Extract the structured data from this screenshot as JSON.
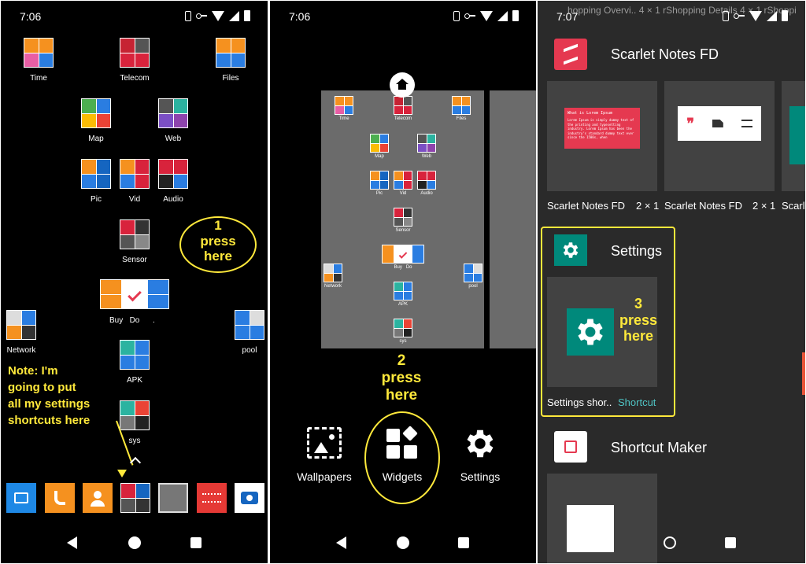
{
  "panel1": {
    "status_time": "7:06",
    "apps": {
      "time": "Time",
      "telecom": "Telecom",
      "files": "Files",
      "map": "Map",
      "web": "Web",
      "pic": "Pic",
      "vid": "Vid",
      "audio": "Audio",
      "sensor": "Sensor",
      "buydo": "Buy   Do      .",
      "network": "Network",
      "pool": "pool",
      "apk": "APK",
      "sys": "sys"
    },
    "annotation_press": "1\npress\nhere",
    "note": "Note: I'm\ngoing to put\nall my settings\nshortcuts here"
  },
  "panel2": {
    "status_time": "7:06",
    "mini_labels": {
      "time": "Time",
      "telecom": "Telecom",
      "files": "Files",
      "map": "Map",
      "web": "Web",
      "pic": "Pic",
      "vid": "Vid",
      "audio": "Audio",
      "sensor": "Sensor",
      "buydo": "Buy   Do",
      "network": "Network",
      "pool": "pool",
      "apk": "APK",
      "sys": "sys"
    },
    "annotation_press": "2\npress\nhere",
    "options": {
      "wallpapers": "Wallpapers",
      "widgets": "Widgets",
      "settings": "Settings"
    }
  },
  "panel3": {
    "status_time": "7:07",
    "status_overlay": "hopping Overvi..  4 × 1   rShopping Details  4 × 1   rShoppi",
    "scarlet": {
      "title": "Scarlet Notes FD",
      "note_title": "What is Lorem Ipsum",
      "note_body": "Lorem Ipsum is simply dummy text of the printing and typesetting industry. Lorem Ipsum has been the industry's standard dummy text ever since the 1500s, when",
      "w1_name": "Scarlet Notes FD",
      "w1_size": "2 × 1",
      "w2_name": "Scarlet Notes FD",
      "w2_size": "2 × 1",
      "w3_name": "Scarl"
    },
    "settings": {
      "title": "Settings",
      "widget_name": "Settings shor..",
      "widget_type": "Shortcut"
    },
    "annotation_press": "3\npress\nhere",
    "shortcut_maker": {
      "title": "Shortcut Maker"
    }
  },
  "colors": {
    "annotation": "#ffe93b",
    "settings_teal": "#00897b",
    "scarlet_red": "#e53950",
    "shortcut_text": "#4fc3c3"
  }
}
